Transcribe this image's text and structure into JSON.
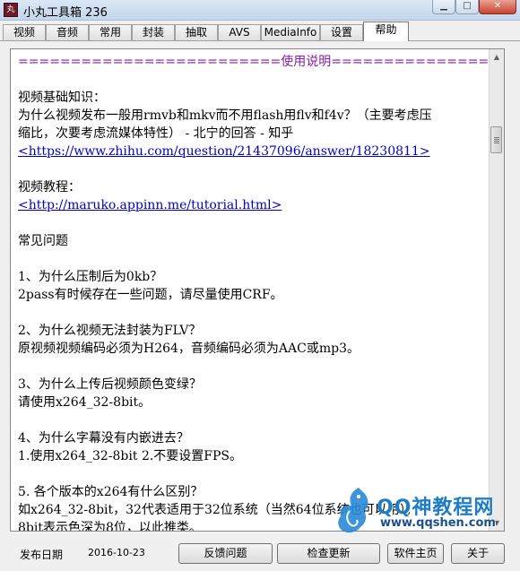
{
  "window": {
    "title": "小丸工具箱 236",
    "app_icon_text": "丸",
    "controls": {
      "minimize": "▁",
      "maximize": "□",
      "close": "✕"
    }
  },
  "tabs": [
    {
      "label": "视频",
      "active": false
    },
    {
      "label": "音频",
      "active": false
    },
    {
      "label": "常用",
      "active": false
    },
    {
      "label": "封装",
      "active": false
    },
    {
      "label": "抽取",
      "active": false
    },
    {
      "label": "AVS",
      "active": false
    },
    {
      "label": "MediaInfo",
      "active": false
    },
    {
      "label": "设置",
      "active": false
    },
    {
      "label": "帮助",
      "active": true
    }
  ],
  "help": {
    "lines": [
      "=========================使用说明=========================",
      "",
      "视频基础知识：",
      "为什么视频发布一般用rmvb和mkv而不用flash用flv和f4v？（主要考虑压",
      "缩比，次要考虑流媒体特性） - 北宁的回答 - 知乎",
      "<https://www.zhihu.com/question/21437096/answer/18230811>",
      "",
      "视频教程：",
      "<http://maruko.appinn.me/tutorial.html>",
      "",
      "常见问题",
      "",
      "1、为什么压制后为0kb？",
      "2pass有时候存在一些问题，请尽量使用CRF。",
      "",
      "2、为什么视频无法封装为FLV？",
      "原视频视频编码必须为H264，音频编码必须为AAC或mp3。",
      "",
      "3、为什么上传后视频颜色变绿？",
      "请使用x264_32-8bit。",
      "",
      "4、为什么字幕没有内嵌进去？",
      "1.使用x264_32-8bit 2.不要设置FPS。",
      "",
      "5. 各个版本的x264有什么区别？",
      "如x264_32-8bit，32代表适用于32位系统（当然64位系统也可以用），",
      "8bit表示色深为8位，以此推类。"
    ]
  },
  "status": {
    "date_label": "发布日期",
    "date_value": "2016-10-23",
    "buttons": {
      "feedback": "反馈问题",
      "check_update": "检查更新",
      "homepage": "软件主页",
      "about": "关于"
    }
  },
  "watermark": {
    "title": "QQ神教程网",
    "url": "www.qqshen.com"
  },
  "colors": {
    "header_text": "#8a1ab0",
    "link_text": "#0000cc",
    "watermark_blue": "#1e7dc4"
  }
}
